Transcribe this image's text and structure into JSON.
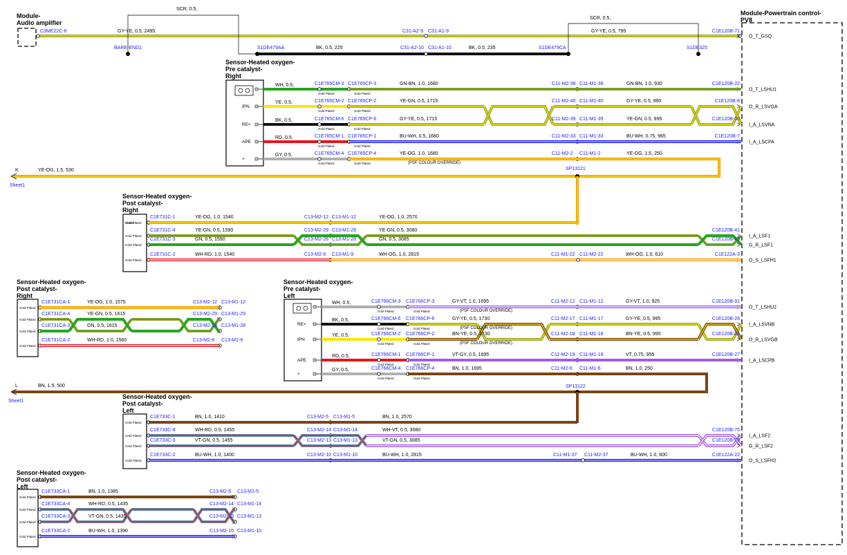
{
  "modules": {
    "audio": {
      "title1": "Module-",
      "title2": "Audio amplifier"
    },
    "pcm": {
      "title1": "Module-Powertrain control-",
      "title2": "PV8"
    }
  },
  "sensors": {
    "pre_right": {
      "l1": "Sensor-Heated oxygen-",
      "l2": "Pre catalyst-",
      "l3": "Right"
    },
    "post_right_a": {
      "l1": "Sensor-Heated oxygen-",
      "l2": "Post catalyst-",
      "l3": "Right"
    },
    "post_right_b": {
      "l1": "Sensor-Heated oxygen-",
      "l2": "Post catalyst-",
      "l3": "Right"
    },
    "pre_left": {
      "l1": "Sensor-Heated oxygen-",
      "l2": "Pre catalyst-",
      "l3": "Left"
    },
    "post_left_a": {
      "l1": "Sensor-Heated oxygen-",
      "l2": "Post catalyst-",
      "l3": "Left"
    },
    "post_left_b": {
      "l1": "Sensor-Heated oxygen-",
      "l2": "Post catalyst-",
      "l3": "Left"
    }
  },
  "pins": {
    "ipn": "IPN",
    "re": "RE+",
    "ape": "APE",
    "plus": "+"
  },
  "gold_plated": "Gold Plated",
  "psf_override": "(PSF COLOUR OVERRIDE)",
  "sheet": "Sheet1",
  "sheet_k": "K",
  "sheet_l": "L",
  "signals": [
    "O_T_GSQ",
    "O_T_LSHU1",
    "O_R_LSVGA",
    "I_A_LSVNA",
    "I_A_LSCPA",
    "I_A_LSF1",
    "G_R_LSF1",
    "O_S_LSFH1",
    "O_T_LSHU2",
    "I_A_LSVNB",
    "O_R_LSVGB",
    "I_A_LSCPB",
    "I_A_LSF2",
    "G_R_LSF2",
    "O_S_LSFH2"
  ],
  "audio": {
    "conn": "C3ME22C-6",
    "spec1": "GY-YE, 0.5, 2495",
    "scr1": "SCR, 0.5,",
    "bare": "BARE-END1",
    "s1de479aa": "S1DE479AA",
    "spec_bk1": "BK, 0.5, 225",
    "c31a210": "C31-A2-10",
    "c31a110": "C31-A1-10",
    "spec_bk2": "BK, 0.5, 235",
    "s1de479ca": "S1DE479CA",
    "c31a29": "C31-A2-9",
    "c31a19": "C31-A1-9",
    "scr2": "SCR, 0.5,",
    "spec2": "GY-YE, 0.5, 795",
    "c1e120b71": "C1E120B-71",
    "s1de325": "S1DE325"
  },
  "pre_right": {
    "rows": [
      {
        "a": "WH, 0.5,",
        "c1": "C1E765CM-3",
        "c2": "C1E765CP-3",
        "s1": "GN-BN, 1.0, 1680",
        "m1": "C11-M2-38",
        "m2": "C11-M1-38",
        "s2": "GN-BN, 1.0, 930",
        "e": "C1E120B-22"
      },
      {
        "a": "YE, 0.5,",
        "c1": "C1E765CM-2",
        "c2": "C1E765CP-2",
        "s1": "YE-GN, 0.5, 1715",
        "m1": "C11-M2-40",
        "m2": "C11-M1-40",
        "s2": "GY-YE, 0.5, 990",
        "e": "C1E120B-8"
      },
      {
        "a": "BK, 0.5,",
        "c1": "C1E765CM-6",
        "c2": "C1E765CP-6",
        "s1": "GY-YE, 0.5, 1715",
        "m1": "C11-M2-39",
        "m2": "C11-M1-39",
        "s2": "YE-GN, 0.5, 995",
        "e": "C1E120B-10"
      },
      {
        "a": "RD, 0.5,",
        "c1": "C1E765CM-1",
        "c2": "C1E765CP-1",
        "s1": "BU-WH, 0.5, 1680",
        "m1": "C11-M2-33",
        "m2": "C11-M1-33",
        "s2": "BU-WH, 0.75, 965",
        "e": "C1E120B-7"
      },
      {
        "a": "GY, 0.5,",
        "c1": "C1E765CM-4",
        "c2": "C1E765CP-4",
        "s1": "YE-OG, 1.0, 1680",
        "m1": "C11-M2-2",
        "m2": "C11-M1-2",
        "s2": "YE-OG, 1.5, 250",
        "e": ""
      }
    ],
    "sp": "SP13121",
    "k_spec": "YE-OG, 1.5, 530"
  },
  "post_right_a": {
    "rows": [
      {
        "c": "C1E731C-1",
        "s1": "YE-OG, 1.0, 1540",
        "m1": "C13-M2-12",
        "m2": "C13-M1-12",
        "s2": "YE-OG, 1.0, 2570",
        "n1": "",
        "n2": "",
        "s3": "",
        "e": ""
      },
      {
        "c": "C1E731C-4",
        "s1": "YE-GN, 0.5, 1590",
        "m1": "C13-M2-29",
        "m2": "C13-M1-29",
        "s2": "YE-GN, 0.5, 3080",
        "n1": "",
        "n2": "",
        "s3": "",
        "e": "C1E120B-41"
      },
      {
        "c": "C1E731C-3",
        "s1": "GN, 0.5, 1590",
        "m1": "C13-M2-28",
        "m2": "C13-M1-28",
        "s2": "GN, 0.5, 3085",
        "n1": "",
        "n2": "",
        "s3": "",
        "e": "C1E120B-43"
      },
      {
        "c": "C1E731C-2",
        "s1": "WH-RD, 1.0, 1540",
        "m1": "C13-M2-9",
        "m2": "C13-M1-9",
        "s2": "WH-OG, 1.0, 2815",
        "n1": "C11-M1-22",
        "n2": "C11-M2-22",
        "s3": "WH-OG, 1.0, 610",
        "e": "C1E122A-3"
      }
    ],
    "shield_text": "Shield"
  },
  "post_right_b": {
    "rows": [
      {
        "c": "C1E731CA-1",
        "s": "YE-OG, 1.0, 1575",
        "m1": "C13-M2-12",
        "m2": "C13-M1-12"
      },
      {
        "c": "C1E731CA-4",
        "s": "YE-GN, 0.5, 1615",
        "m1": "C13-M2-29",
        "m2": "C13-M1-29"
      },
      {
        "c": "C1E731CA-3",
        "s": "GN, 0.5, 1615",
        "m1": "C13-M2-28",
        "m2": "C13-M1-28"
      },
      {
        "c": "C1E731CA-2",
        "s": "WH-RD, 1.0, 1560",
        "m1": "C13-M2-9",
        "m2": "C13-M1-9"
      }
    ]
  },
  "pre_left": {
    "rows": [
      {
        "a": "WH, 0.5,",
        "c1": "C1E766CM-3",
        "c2": "C1E766CP-3",
        "s1": "GY-VT, 1.0, 1695",
        "m1": "C11-M2-12",
        "m2": "C11-M1-12",
        "s2": "GY-VT, 1.0, 925",
        "e": "C1E120B-91"
      },
      {
        "a": "BK, 0.5,",
        "c1": "C1E766CM-6",
        "c2": "C1E766CP-6",
        "s1": "GY-YE, 0.5, 1730",
        "m1": "C11-M2-17",
        "m2": "C11-M1-17",
        "s2": "GY-YE, 0.5, 995",
        "e": "C1E120B-26"
      },
      {
        "a": "YE, 0.5,",
        "c1": "C1E766CM-2",
        "c2": "C1E766CP-2",
        "s1": "BN-YE, 0.5, 1730",
        "m1": "C11-M2-18",
        "m2": "C11-M1-18",
        "s2": "BN-YE, 0.5, 995",
        "e": "C1E120B-25"
      },
      {
        "a": "RD, 0.5,",
        "c1": "C1E766CM-1",
        "c2": "C1E766CP-1",
        "s1": "VT-GY, 0.5, 1695",
        "m1": "C11-M2-19",
        "m2": "C11-M1-19",
        "s2": "VT, 0.75, 955",
        "e": "C1E120B-27"
      },
      {
        "a": "GY, 0.5,",
        "c1": "C1E766CM-4",
        "c2": "C1E766CP-4",
        "s1": "BN, 1.0, 1695",
        "m1": "C11-M2-6",
        "m2": "C11-M1-6",
        "s2": "BN, 1.0, 250",
        "e": ""
      }
    ],
    "sp": "SP13122",
    "l_spec": "BN, 1.5, 500"
  },
  "post_left_a": {
    "rows": [
      {
        "c": "C1E733C-1",
        "s1": "BN, 1.0, 1410",
        "m1": "C13-M2-5",
        "m2": "C13-M1-5",
        "s2": "BN, 1.0, 2570",
        "n1": "",
        "n2": "",
        "s3": "",
        "e": ""
      },
      {
        "c": "C1E733C-4",
        "s1": "WH-RD, 0.5, 1455",
        "m1": "C13-M2-14",
        "m2": "C13-M1-14",
        "s2": "WH-VT, 0.5, 3080",
        "n1": "",
        "n2": "",
        "s3": "",
        "e": "C1E120B-75"
      },
      {
        "c": "C1E733C-3",
        "s1": "VT-GN, 0.5, 1455",
        "m1": "C13-M2-13",
        "m2": "C13-M1-13",
        "s2": "VT-GN, 0.5, 3085",
        "n1": "",
        "n2": "",
        "s3": "",
        "e": "C1E120B-76"
      },
      {
        "c": "C1E733C-2",
        "s1": "BU-WH, 1.0, 1400",
        "m1": "C13-M2-10",
        "m2": "C13-M1-10",
        "s2": "BU-WH, 1.0, 2815",
        "n1": "C11-M1-37",
        "n2": "C11-M2-37",
        "s3": "BU-WH, 1.0, 600",
        "e": "C1E122A-22"
      }
    ]
  },
  "post_left_b": {
    "rows": [
      {
        "c": "C1E733CA-1",
        "s": "BN, 1.0, 1385",
        "m1": "C13-M2-5",
        "m2": "C13-M1-5"
      },
      {
        "c": "C1E733CA-4",
        "s": "WH-RD, 0.5, 1435",
        "m1": "C13-M2-14",
        "m2": "C13-M1-14"
      },
      {
        "c": "C1E733CA-3",
        "s": "VT-GN, 0.5, 1435",
        "m1": "C13-M2-13",
        "m2": "C13-M1-13"
      },
      {
        "c": "C1E733CA-2",
        "s": "BU-WH, 1.0, 1390",
        "m1": "C13-M2-10",
        "m2": "C13-M1-10"
      }
    ]
  },
  "colors": {
    "yellow": "#f5e600",
    "green": "#27a51e",
    "black": "#111111",
    "red": "#e8141b",
    "gray": "#b0b0b0",
    "orange": "#f59a00",
    "brown": "#7a4514",
    "blue": "#1a1aff",
    "violet": "#a35be5",
    "teal": "#5a8fb0",
    "olive": "#9ba532"
  }
}
